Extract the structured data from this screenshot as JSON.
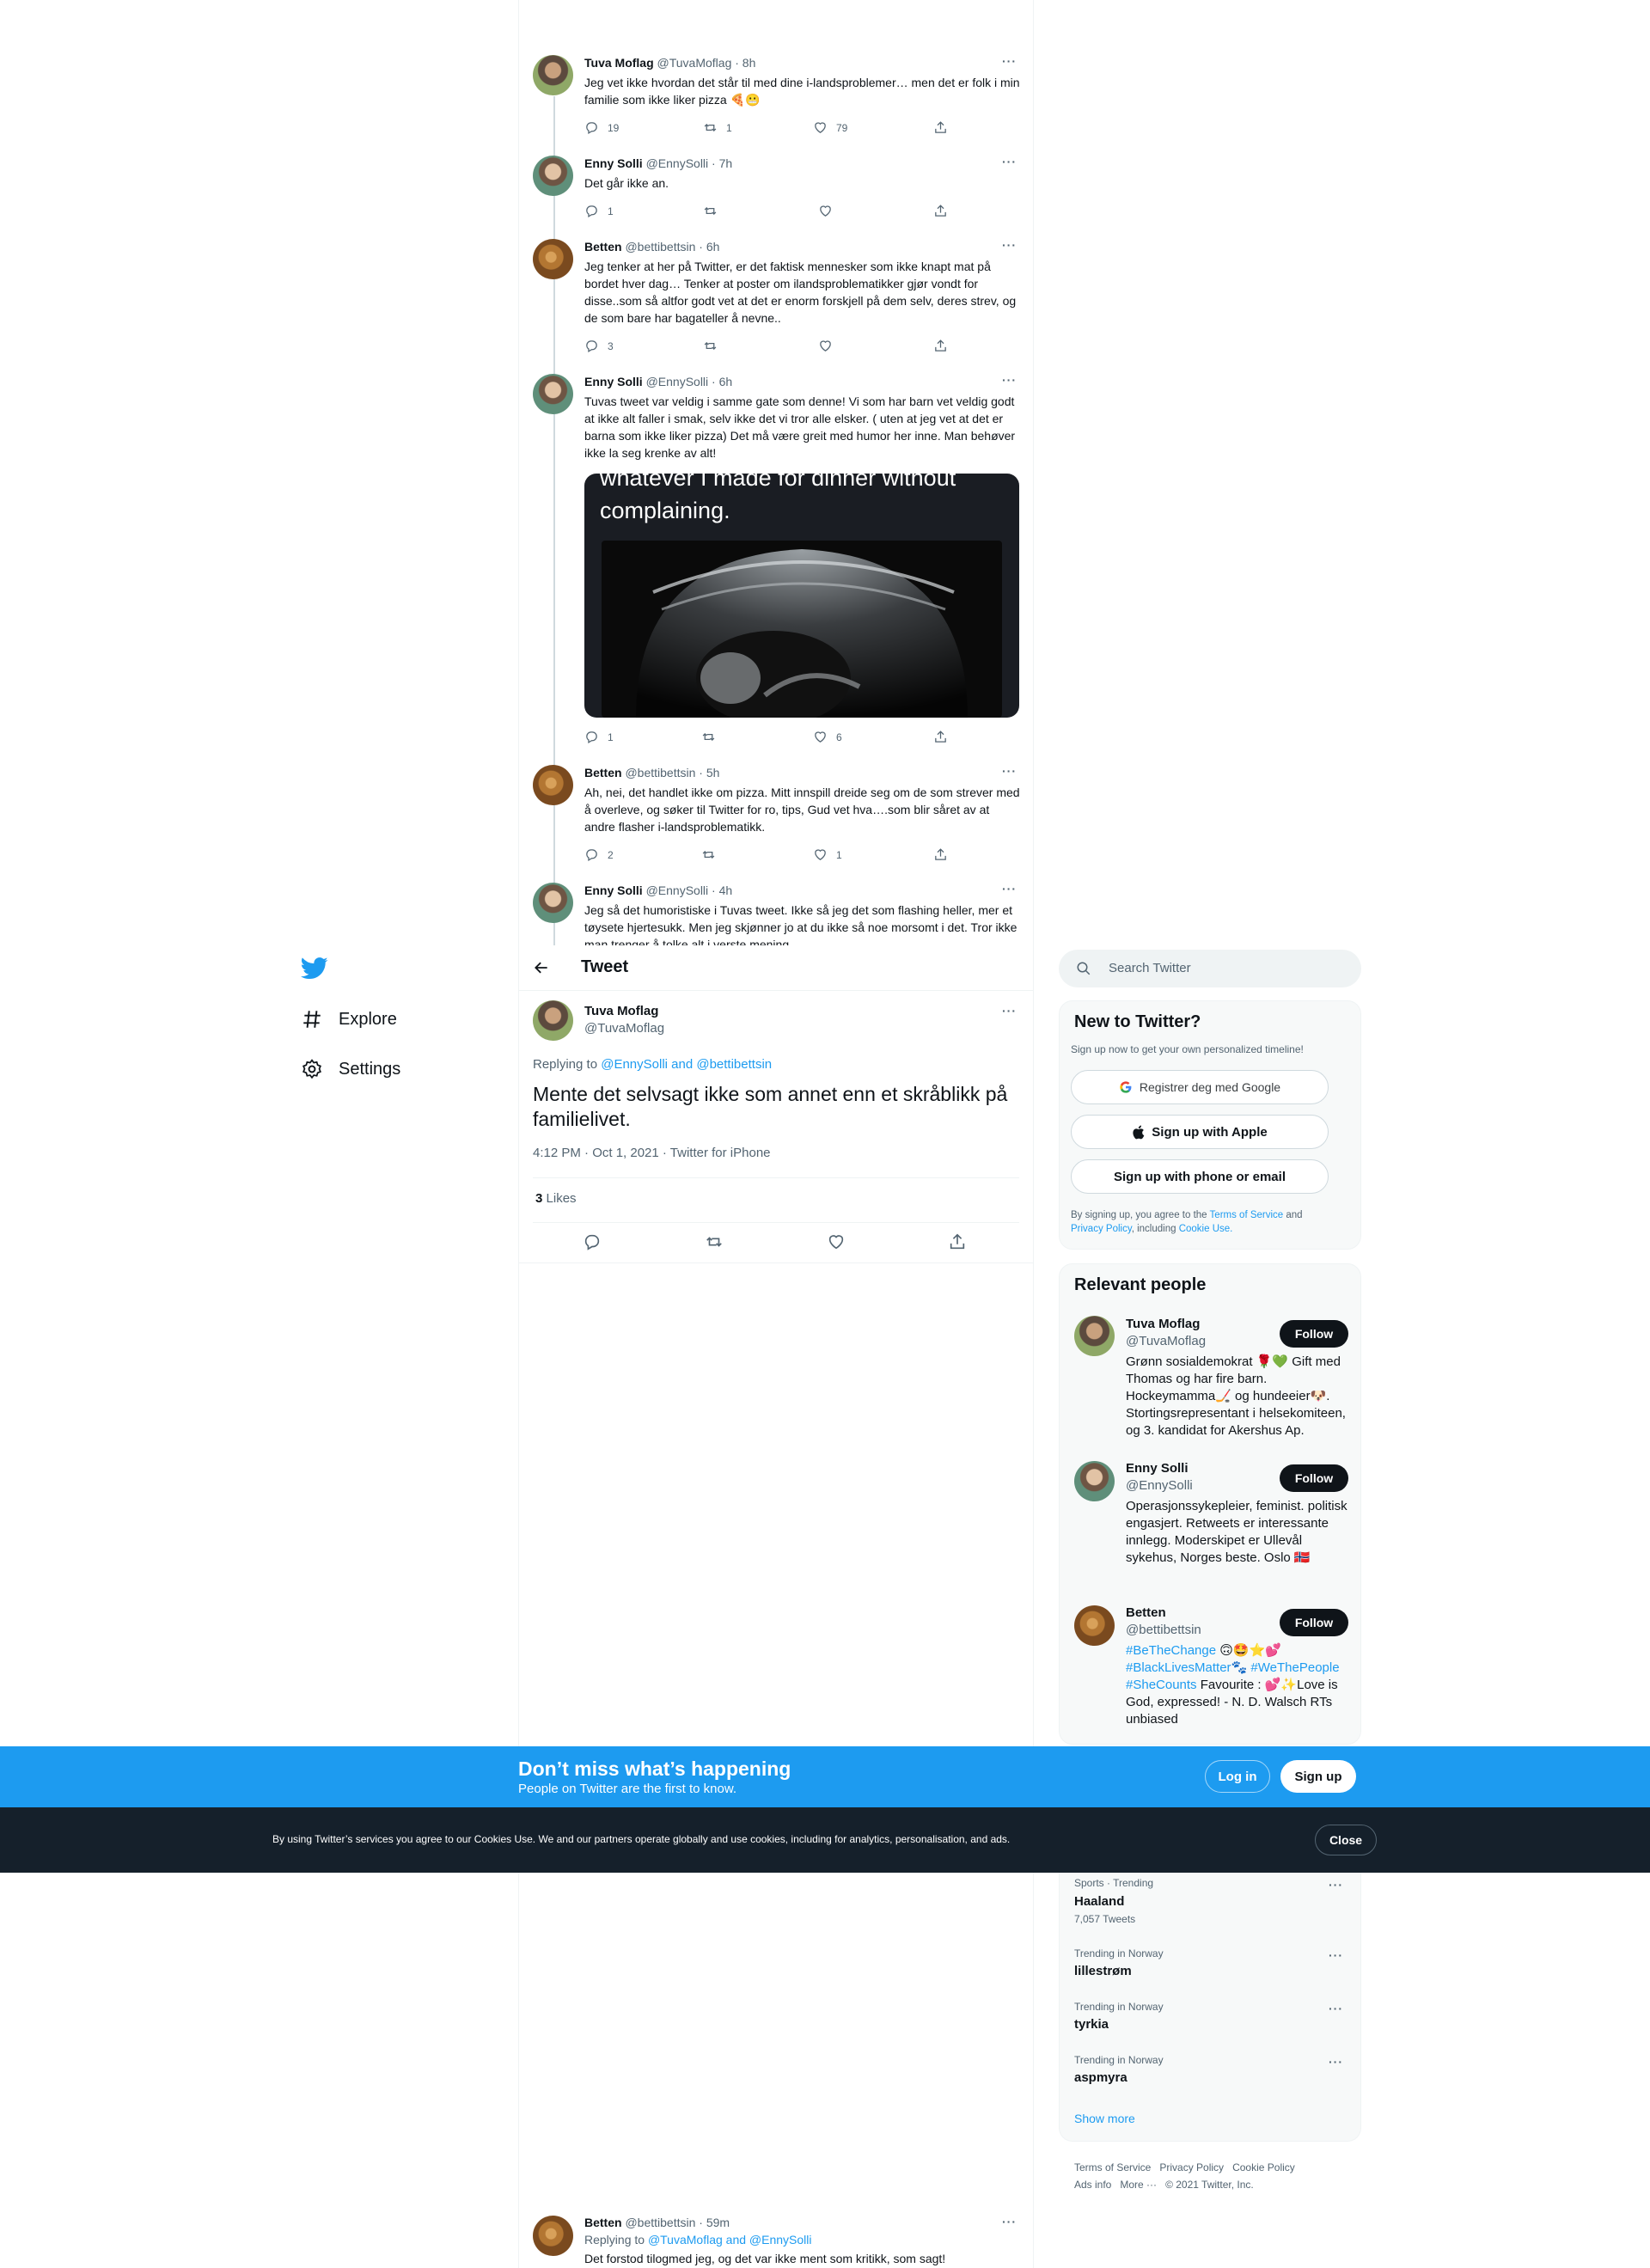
{
  "thread": [
    {
      "name": "Tuva Moflag",
      "handle": "@TuvaMoflag · 8h",
      "text": "Jeg vet ikke hvordan det står til med dine i-landsproblemer… men det er folk i min familie som ikke liker pizza 🍕😬",
      "replies": "19",
      "retweets": "1",
      "likes": "79"
    },
    {
      "name": "Enny Solli",
      "handle": "@EnnySolli · 7h",
      "text": "Det går ikke an.",
      "replies": "1",
      "retweets": "",
      "likes": ""
    },
    {
      "name": "Betten",
      "handle": "@bettibettsin · 6h",
      "text": "Jeg tenker at her på Twitter, er det faktisk mennesker som ikke knapt mat på bordet hver dag… Tenker at poster om ilandsproblematikker gjør vondt for disse..som så altfor godt vet at det er enorm forskjell på dem selv, deres strev,  og de som bare har bagateller å nevne..",
      "replies": "3",
      "retweets": "",
      "likes": ""
    },
    {
      "name": "Enny Solli",
      "handle": "@EnnySolli · 6h",
      "text": "Tuvas tweet var veldig i samme gate som denne! Vi som har barn vet veldig godt at ikke alt faller i smak, selv ikke det vi tror alle elsker. ( uten at jeg vet at det er barna som ikke liker pizza) Det må være greit med humor her inne. Man behøver ikke la seg krenke av alt!",
      "media_caption_1": "whatever I made for dinner without",
      "media_caption_2": "complaining.",
      "replies": "1",
      "retweets": "",
      "likes": "6"
    },
    {
      "name": "Betten",
      "handle": "@bettibettsin · 5h",
      "text": "Ah, nei, det handlet ikke om pizza. Mitt innspill dreide seg om de som strever med å overleve, og søker til Twitter for ro, tips, Gud vet hva….som blir såret av at andre flasher i-landsproblematikk.",
      "replies": "2",
      "retweets": "",
      "likes": "1"
    },
    {
      "name": "Enny Solli",
      "handle": "@EnnySolli · 4h",
      "text": "Jeg så det humoristiske i Tuvas tweet. Ikke så jeg det som flashing heller, mer et tøysete  hjertesukk. Men jeg skjønner jo at du ikke så noe morsomt i det. Tror ikke man trenger å tolke alt i verste mening"
    }
  ],
  "nav": {
    "explore": "Explore",
    "settings": "Settings"
  },
  "header": {
    "title": "Tweet"
  },
  "main_tweet": {
    "name": "Tuva Moflag",
    "handle": "@TuvaMoflag",
    "replying_prefix": "Replying to ",
    "replying_to": "@EnnySolli and @bettibettsin",
    "text": "Mente det selvsagt ikke som annet enn et skråblikk på familielivet.",
    "timestamp": "4:12 PM · Oct 1, 2021 · Twitter for iPhone",
    "likes_count": "3",
    "likes_label": "Likes"
  },
  "search": {
    "placeholder": "Search Twitter"
  },
  "signup_card": {
    "title": "New to Twitter?",
    "subtitle": "Sign up now to get your own personalized timeline!",
    "google": "Registrer deg med Google",
    "apple": "Sign up with Apple",
    "phone": "Sign up with phone or email",
    "terms_1": "By signing up, you agree to the ",
    "terms_link": "Terms of Service",
    "terms_2": " and",
    "privacy_link": "Privacy Policy",
    "terms_3": ", including ",
    "cookie_link": "Cookie Use."
  },
  "relevant": {
    "title": "Relevant people",
    "follow": "Follow",
    "people": [
      {
        "name": "Tuva Moflag",
        "handle": "@TuvaMoflag",
        "bio": "Grønn sosialdemokrat 🌹💚 Gift med Thomas og har fire barn. Hockeymamma🏒 og hundeeier🐶. Stortingsrepresentant i helsekomiteen, og 3. kandidat for Akershus Ap."
      },
      {
        "name": "Enny Solli",
        "handle": "@EnnySolli",
        "bio": "Operasjonssykepleier, feminist. politisk engasjert. Retweets er interessante innlegg. Moderskipet er Ullevål sykehus, Norges beste. Oslo 🇳🇴"
      },
      {
        "name": "Betten",
        "handle": "@bettibettsin",
        "bio_tags_1": "#BeTheChange",
        "bio_emoji_1": " 🙃🤩⭐💕",
        "bio_tags_2": "#BlackLivesMatter",
        "bio_emoji_2": "🐾 ",
        "bio_tags_3": "#WeThePeople",
        "bio_tags_4": "#SheCounts",
        "bio_rest": " Favourite : 💕✨Love is God, expressed! - N. D. Walsch RTs unbiased"
      }
    ]
  },
  "banner": {
    "title": "Don’t miss what’s happening",
    "subtitle": "People on Twitter are the first to know.",
    "login": "Log in",
    "signup": "Sign up"
  },
  "cookie": {
    "text": "By using Twitter’s services you agree to our Cookies Use. We and our partners operate globally and use cookies, including for analytics, personalisation, and ads.",
    "close": "Close"
  },
  "trends": [
    {
      "meta": "Sports · Trending",
      "name": "Haaland",
      "count": "7,057 Tweets"
    },
    {
      "meta": "Trending in Norway",
      "name": "lillestrøm"
    },
    {
      "meta": "Trending in Norway",
      "name": "tyrkia"
    },
    {
      "meta": "Trending in Norway",
      "name": "aspmyra"
    }
  ],
  "show_more": "Show more",
  "footer": {
    "terms": "Terms of Service",
    "privacy": "Privacy Policy",
    "cookie": "Cookie Policy",
    "ads": "Ads info",
    "more": "More ···",
    "copyright": "© 2021 Twitter, Inc."
  },
  "reply": {
    "name": "Betten",
    "handle": "@bettibettsin · 59m",
    "replying_prefix": "Replying to ",
    "replying_to": "@TuvaMoflag and @EnnySolli",
    "text": "Det forstod tilogmed jeg, og det var ikke ment som kritikk, som sagt!"
  },
  "colors": {
    "accent": "#1d9bf0",
    "text": "#0f1419",
    "muted": "#536471",
    "cookie_bar": "#15202b"
  }
}
